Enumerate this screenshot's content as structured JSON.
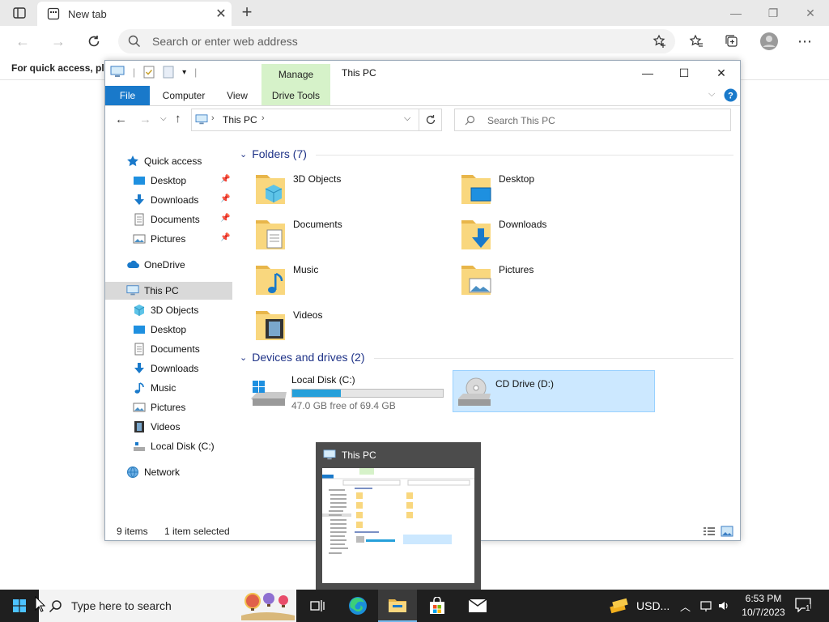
{
  "browser": {
    "tab_title": "New tab",
    "address_placeholder": "Search or enter web address",
    "favorites_bar_text": "For quick access, place your favorites here"
  },
  "explorer": {
    "title": "This PC",
    "manage_label": "Manage",
    "ribbon_tabs": [
      "File",
      "Computer",
      "View",
      "Drive Tools"
    ],
    "path_segment": "This PC",
    "search_placeholder": "Search This PC",
    "sidebar": {
      "quick_access": "Quick access",
      "quick_items": [
        "Desktop",
        "Downloads",
        "Documents",
        "Pictures"
      ],
      "onedrive": "OneDrive",
      "this_pc": "This PC",
      "pc_items": [
        "3D Objects",
        "Desktop",
        "Documents",
        "Downloads",
        "Music",
        "Pictures",
        "Videos",
        "Local Disk (C:)"
      ],
      "network": "Network"
    },
    "folders_header": "Folders (7)",
    "folders": [
      "3D Objects",
      "Desktop",
      "Documents",
      "Downloads",
      "Music",
      "Pictures",
      "Videos"
    ],
    "devices_header": "Devices and drives (2)",
    "drives": [
      {
        "name": "Local Disk (C:)",
        "free_text": "47.0 GB free of 69.4 GB",
        "used_fraction": 0.32
      },
      {
        "name": "CD Drive (D:)"
      }
    ],
    "status_items": "9 items",
    "status_selected": "1 item selected"
  },
  "thumbnail": {
    "title": "This PC"
  },
  "taskbar": {
    "search_placeholder": "Type here to search",
    "weather": "USD...",
    "time": "6:53 PM",
    "date": "10/7/2023",
    "notification_count": "1"
  },
  "colors": {
    "accent": "#1979ca",
    "manage_tab": "#d6f2c9",
    "selection": "#cce8ff",
    "taskbar": "#1f1f1f"
  }
}
